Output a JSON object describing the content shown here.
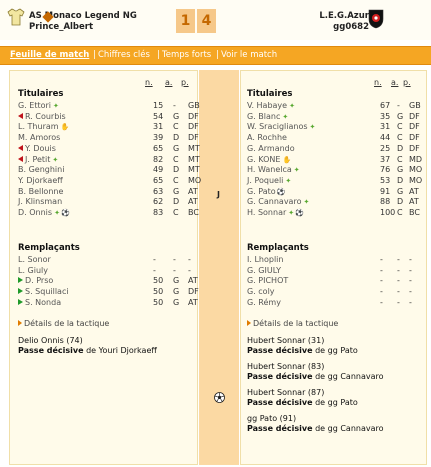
{
  "header": {
    "home_team": "AS Monaco Legend NG",
    "home_manager": "Prince_Albert",
    "score_home": "1",
    "score_away": "4",
    "away_team": "L.E.G.Azur",
    "away_manager": "gg0682",
    "home_shirt_color": "#f2e6a0",
    "away_badge_colors": [
      "#111111",
      "#d01e1e"
    ]
  },
  "tabs": [
    {
      "label": "Feuille de match",
      "active": true
    },
    {
      "label": "Chiffres clés",
      "active": false
    },
    {
      "label": "Temps forts",
      "active": false
    },
    {
      "label": "Voir le match",
      "active": false
    }
  ],
  "columns": {
    "n": "n.",
    "a": "a.",
    "p": "p."
  },
  "home": {
    "starters_title": "Titulaires",
    "starters": [
      {
        "name": "G. Ettori",
        "n": "15",
        "a": "-",
        "p": "GB",
        "mark": "",
        "icon": "star"
      },
      {
        "name": "R. Courbis",
        "n": "54",
        "a": "G",
        "p": "DF",
        "mark": "red",
        "icon": ""
      },
      {
        "name": "L. Thuram",
        "n": "31",
        "a": "C",
        "p": "DF",
        "mark": "",
        "icon": "hand"
      },
      {
        "name": "M. Amoros",
        "n": "39",
        "a": "D",
        "p": "DF",
        "mark": "",
        "icon": ""
      },
      {
        "name": "Y. Douis",
        "n": "65",
        "a": "G",
        "p": "MT",
        "mark": "red",
        "icon": ""
      },
      {
        "name": "J. Petit",
        "n": "82",
        "a": "C",
        "p": "MT",
        "mark": "red",
        "icon": "star"
      },
      {
        "name": "B. Genghini",
        "n": "49",
        "a": "D",
        "p": "MT",
        "mark": "",
        "icon": ""
      },
      {
        "name": "Y. Djorkaeff",
        "n": "65",
        "a": "C",
        "p": "MO",
        "mark": "",
        "icon": ""
      },
      {
        "name": "B. Bellonne",
        "n": "63",
        "a": "G",
        "p": "AT",
        "mark": "",
        "icon": ""
      },
      {
        "name": "J. Klinsman",
        "n": "62",
        "a": "D",
        "p": "AT",
        "mark": "",
        "icon": ""
      },
      {
        "name": "D. Onnis",
        "n": "83",
        "a": "C",
        "p": "BC",
        "mark": "",
        "icon": "star-ball"
      }
    ],
    "subs_title": "Remplaçants",
    "subs": [
      {
        "name": "L. Sonor",
        "n": "-",
        "a": "-",
        "p": "-",
        "mark": ""
      },
      {
        "name": "L. Giuly",
        "n": "-",
        "a": "-",
        "p": "-",
        "mark": ""
      },
      {
        "name": "D. Prso",
        "n": "50",
        "a": "G",
        "p": "AT",
        "mark": "green"
      },
      {
        "name": "S. Squillaci",
        "n": "50",
        "a": "G",
        "p": "DF",
        "mark": "green"
      },
      {
        "name": "S. Nonda",
        "n": "50",
        "a": "G",
        "p": "AT",
        "mark": "green"
      }
    ],
    "tactics_link": "Détails de la tactique",
    "events": [
      {
        "scorer": "Delio Onnis (74)",
        "assist_label": "Passe décisive",
        "assist_text": " de Youri Djorkaeff"
      }
    ]
  },
  "away": {
    "starters_title": "Titulaires",
    "starters": [
      {
        "name": "V. Habaye",
        "n": "67",
        "a": "-",
        "p": "GB",
        "icon": "star"
      },
      {
        "name": "G. Blanc",
        "n": "35",
        "a": "G",
        "p": "DF",
        "icon": "star"
      },
      {
        "name": "W. Sraciglianos",
        "n": "31",
        "a": "C",
        "p": "DF",
        "icon": "star"
      },
      {
        "name": "A. Rochhe",
        "n": "44",
        "a": "C",
        "p": "DF",
        "icon": ""
      },
      {
        "name": "G. Armando",
        "n": "25",
        "a": "D",
        "p": "DF",
        "icon": ""
      },
      {
        "name": "G. KONE",
        "n": "37",
        "a": "C",
        "p": "MD",
        "icon": "hand"
      },
      {
        "name": "H. Wanelca",
        "n": "76",
        "a": "G",
        "p": "MO",
        "icon": "star"
      },
      {
        "name": "J. Poqueli",
        "n": "53",
        "a": "D",
        "p": "MO",
        "icon": "star"
      },
      {
        "name": "G. Pato",
        "n": "91",
        "a": "G",
        "p": "AT",
        "icon": "ball"
      },
      {
        "name": "G. Cannavaro",
        "n": "88",
        "a": "D",
        "p": "AT",
        "icon": "star"
      },
      {
        "name": "H. Sonnar",
        "n": "100",
        "a": "C",
        "p": "BC",
        "icon": "star-ball"
      }
    ],
    "subs_title": "Remplaçants",
    "subs": [
      {
        "name": "I. Lhoplin",
        "n": "-",
        "a": "-",
        "p": "-"
      },
      {
        "name": "G. GIULY",
        "n": "-",
        "a": "-",
        "p": "-"
      },
      {
        "name": "G. PICHOT",
        "n": "-",
        "a": "-",
        "p": "-"
      },
      {
        "name": "G. coly",
        "n": "-",
        "a": "-",
        "p": "-"
      },
      {
        "name": "G. Rémy",
        "n": "-",
        "a": "-",
        "p": "-"
      }
    ],
    "tactics_link": "Détails de la tactique",
    "events": [
      {
        "scorer": "Hubert Sonnar (31)",
        "assist_label": "Passe décisive",
        "assist_text": " de gg Pato"
      },
      {
        "scorer": "Hubert Sonnar (83)",
        "assist_label": "Passe décisive",
        "assist_text": " de gg Cannavaro"
      },
      {
        "scorer": "Hubert Sonnar (87)",
        "assist_label": "Passe décisive",
        "assist_text": " de gg Pato"
      },
      {
        "scorer": "gg Pato (91)",
        "assist_label": "Passe décisive",
        "assist_text": " de gg Cannavaro"
      }
    ]
  },
  "middle": {
    "letter": "J"
  }
}
